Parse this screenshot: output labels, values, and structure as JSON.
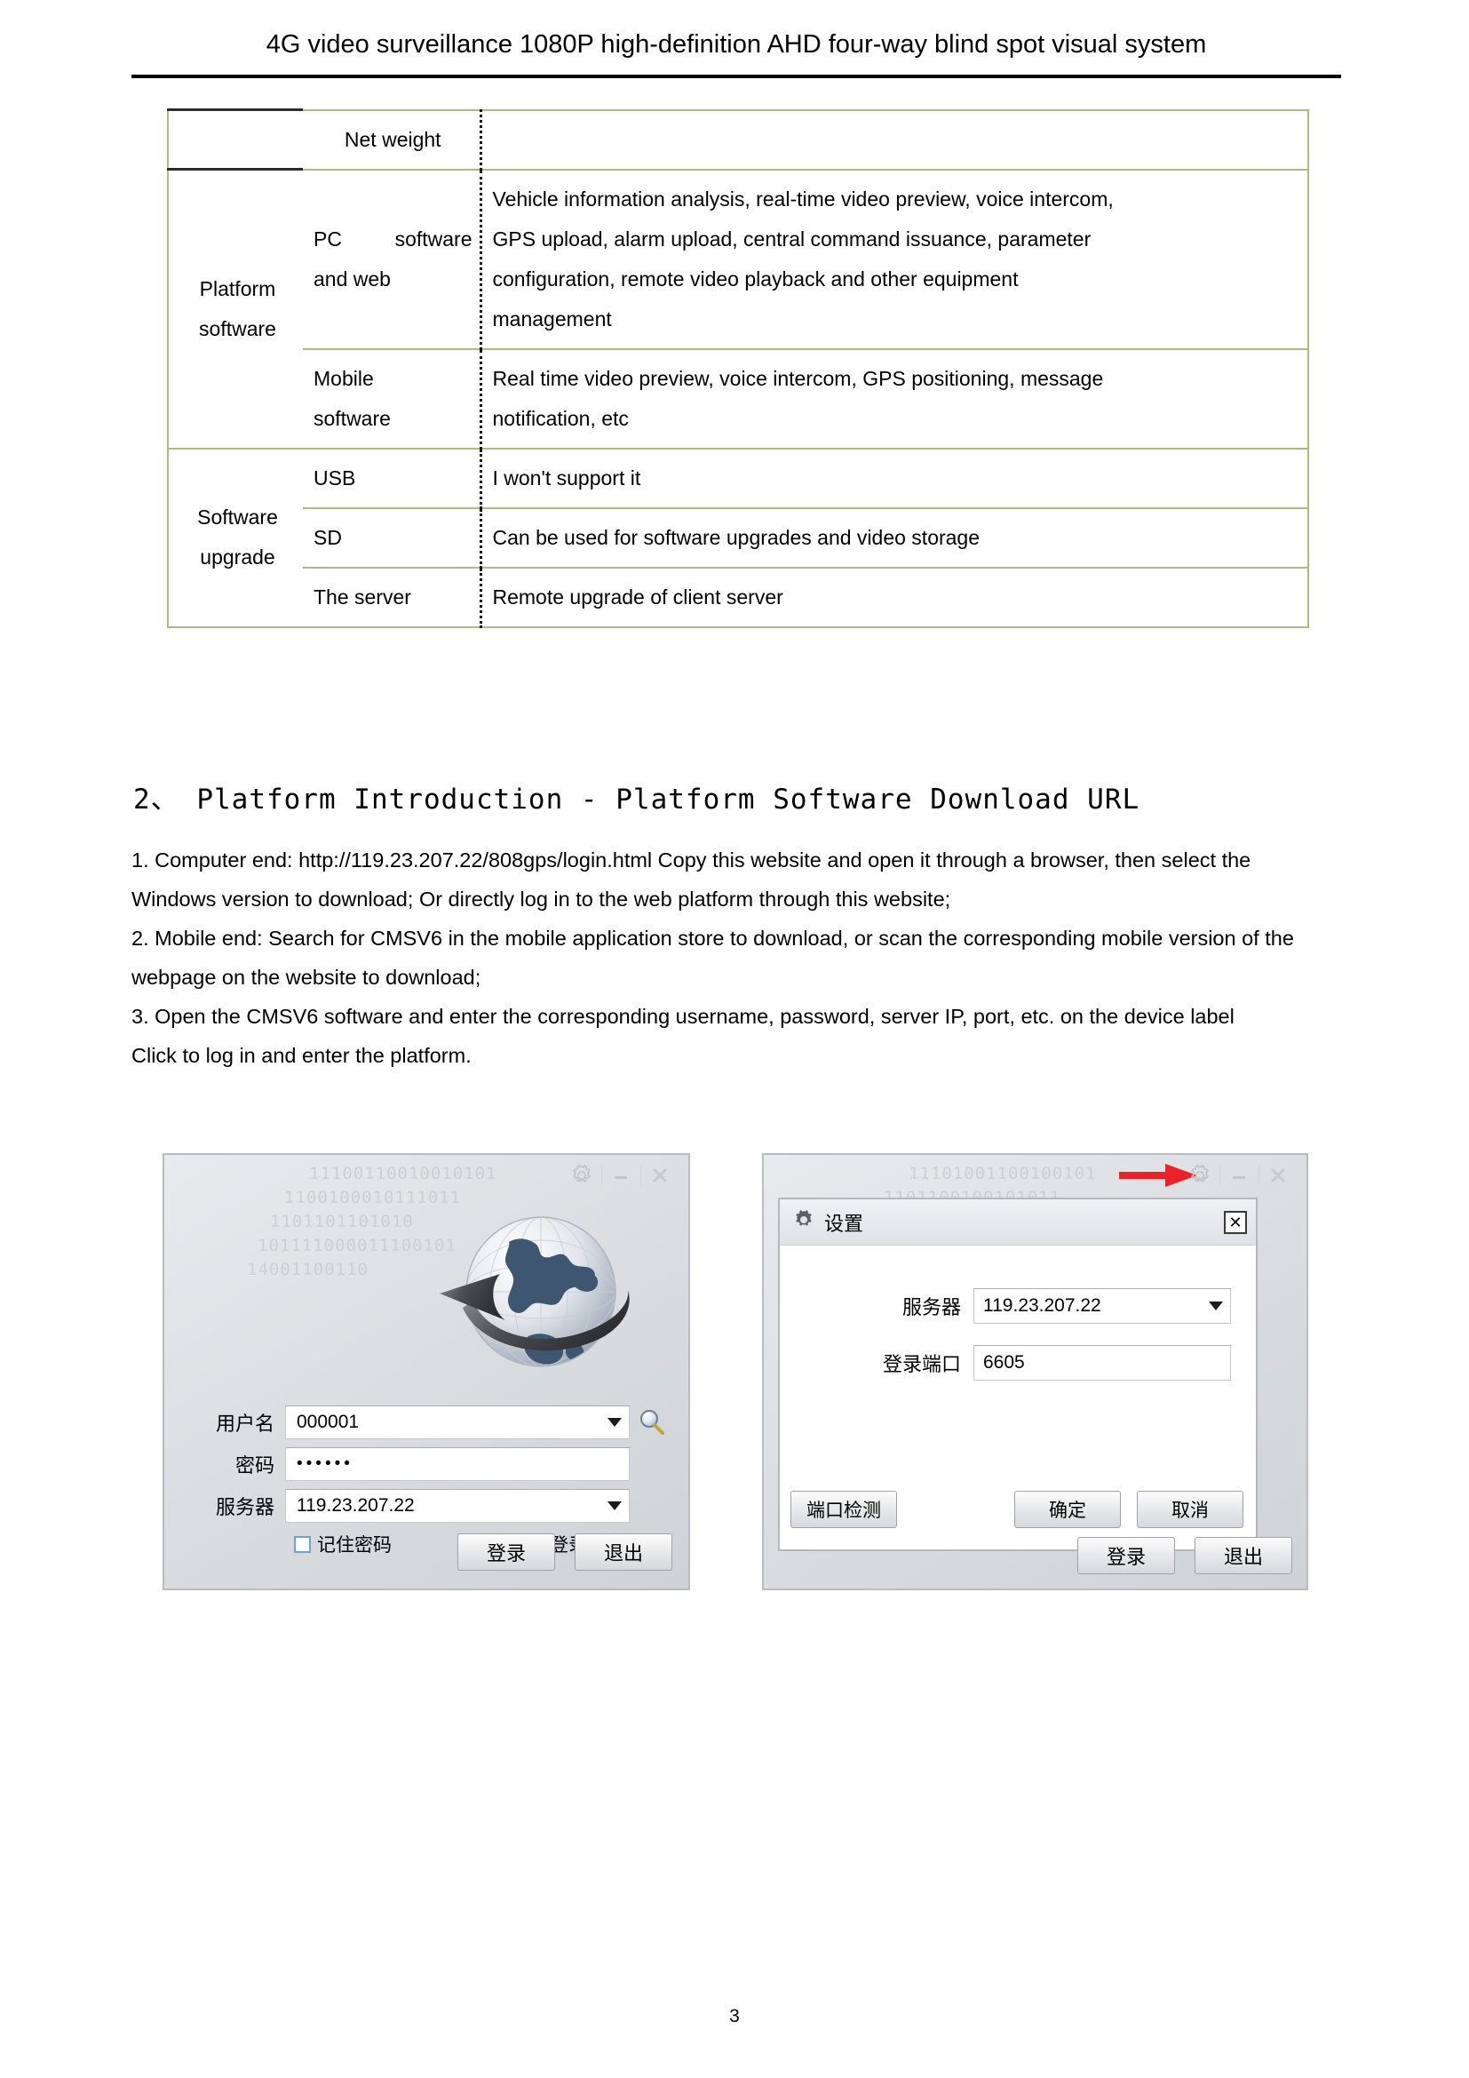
{
  "header": {
    "title": "4G video surveillance 1080P high-definition AHD four-way blind spot visual system"
  },
  "spec_table": {
    "rows": [
      {
        "group": "",
        "item": "Net weight",
        "value": ""
      },
      {
        "group": "Platform software",
        "group_line1": "Platform",
        "group_line2": "software",
        "item": "PC software and web",
        "item_line1": "PC",
        "item_line1b": "software",
        "item_line2": "and web",
        "value_lines": [
          "Vehicle information analysis, real-time video preview, voice intercom,",
          "GPS upload, alarm upload, central command issuance, parameter",
          "configuration, remote video playback and other equipment",
          "management"
        ]
      },
      {
        "group": "",
        "item": "Mobile software",
        "item_line1": "Mobile",
        "item_line2": "software",
        "value_lines": [
          "Real time video preview, voice intercom, GPS positioning, message",
          "notification, etc"
        ]
      },
      {
        "group": "Software upgrade",
        "group_line1": "Software",
        "group_line2": "upgrade",
        "item": "USB",
        "value": "I won't support it"
      },
      {
        "group": "",
        "item": "SD",
        "value": "Can be used for software upgrades and video storage"
      },
      {
        "group": "",
        "item": "The server",
        "value": "Remote upgrade of client server"
      }
    ]
  },
  "section": {
    "heading": "2、 Platform Introduction - Platform Software Download URL",
    "paragraphs": [
      "1. Computer end: http://119.23.207.22/808gps/login.html Copy this website and open it through a browser, then select the Windows version to download; Or directly log in to the web platform through this website;",
      "2. Mobile end: Search for CMSV6 in the mobile application store to download, or scan the corresponding mobile version of the webpage on the website to download;",
      "3. Open the CMSV6 software and enter the corresponding username, password, server IP, port, etc. on the device label",
      "Click to log in and enter the platform."
    ]
  },
  "login_window": {
    "binary_lines": [
      "11100110010010101",
      "1100100010111011",
      "1101101101010",
      "101111000011100101",
      "14001100110"
    ],
    "controls": {
      "settings": "gear",
      "minimize": "minimize",
      "close": "close"
    },
    "fields": {
      "username_label": "用户名",
      "username_value": "000001",
      "password_label": "密码",
      "password_value": "••••••",
      "server_label": "服务器",
      "server_value": "119.23.207.22"
    },
    "checkboxes": [
      {
        "label": "记住密码",
        "checked": false
      },
      {
        "label": "自动登录",
        "checked": false
      }
    ],
    "buttons": {
      "login": "登录",
      "exit": "退出"
    }
  },
  "settings_window": {
    "binary_lines": [
      "11101001100100101",
      "1101100100101011"
    ],
    "modal": {
      "title": "设置",
      "close": "✕",
      "server_label": "服务器",
      "server_value": "119.23.207.22",
      "port_label": "登录端口",
      "port_value": "6605",
      "buttons": {
        "port_test": "端口检测",
        "ok": "确定",
        "cancel": "取消"
      }
    },
    "buttons": {
      "login": "登录",
      "exit": "退出"
    },
    "annotation": "red-arrow-to-settings-gear"
  },
  "footer": {
    "page_number": "3"
  },
  "colors": {
    "table_border_green": "#a8bd7e",
    "dark_rule": "#2b2b2b",
    "arrow_red": "#e8232a",
    "checkbox_blue": "#6aa5d8"
  }
}
